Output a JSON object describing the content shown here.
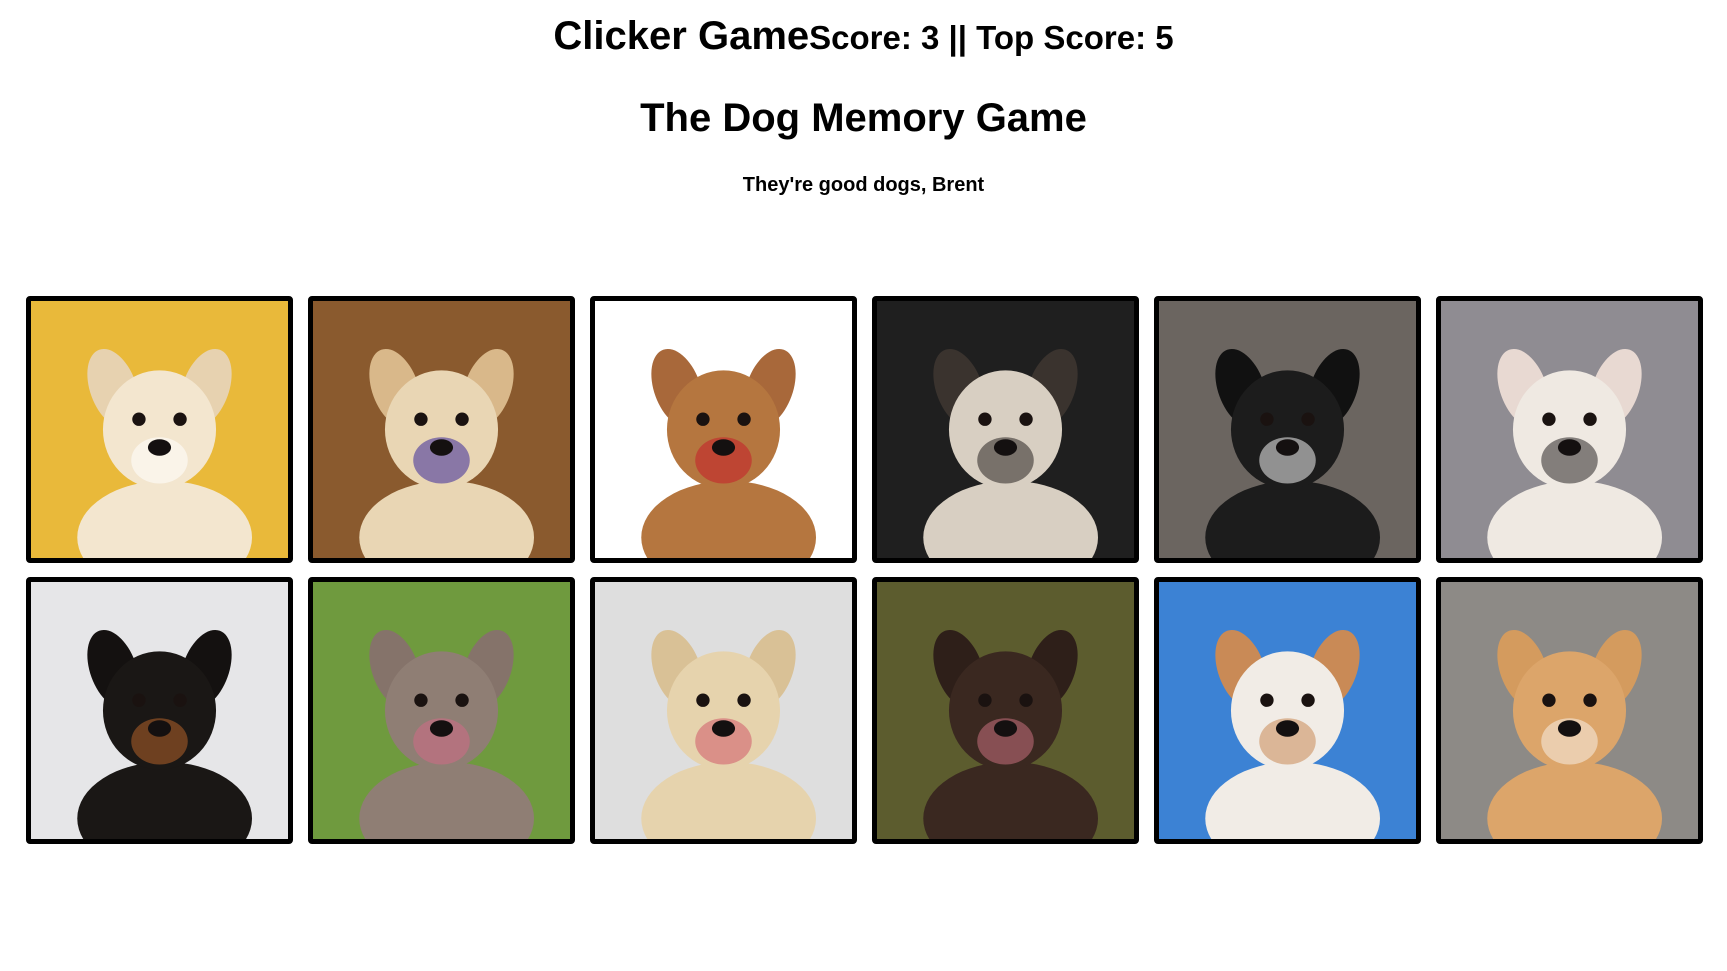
{
  "navbar": {
    "brand": "Clicker Game",
    "score_text": "Score: 3 || Top Score: 5"
  },
  "jumbotron": {
    "title": "The Dog Memory Game",
    "subtitle": "They're good dogs, Brent"
  },
  "cards": [
    {
      "icon": "golden-puppy-stethoscope-image",
      "bg": "#e9b93a",
      "fur": "#f3e6cf",
      "ear": "#e7d2b0",
      "accent": "#ffffff"
    },
    {
      "icon": "labrador-sunglasses-image",
      "bg": "#8a5a2e",
      "fur": "#e9d6b4",
      "ear": "#d9b88a",
      "accent": "#3a2a9a"
    },
    {
      "icon": "pitbull-rose-image",
      "bg": "#ffffff",
      "fur": "#b5763f",
      "ear": "#a8683a",
      "accent": "#c41e2a"
    },
    {
      "icon": "pug-portrait-image",
      "bg": "#1f1f1f",
      "fur": "#d8cfc2",
      "ear": "#3a332e",
      "accent": "#2a2522"
    },
    {
      "icon": "black-white-puppy-image",
      "bg": "#6b6560",
      "fur": "#1c1c1c",
      "ear": "#111111",
      "accent": "#f2f2f2"
    },
    {
      "icon": "french-bulldog-image",
      "bg": "#8f8c92",
      "fur": "#efe9e2",
      "ear": "#e8d9d2",
      "accent": "#2a2626"
    },
    {
      "icon": "rottweiler-image",
      "bg": "#e6e6e8",
      "fur": "#1a1715",
      "ear": "#141110",
      "accent": "#b5622a"
    },
    {
      "icon": "grey-pitbull-image",
      "bg": "#6f9a3e",
      "fur": "#8f7e74",
      "ear": "#85736a",
      "accent": "#d26a86"
    },
    {
      "icon": "terrier-licking-image",
      "bg": "#dedede",
      "fur": "#e6d3ad",
      "ear": "#d9c196",
      "accent": "#cf5a6a"
    },
    {
      "icon": "chocolate-lab-image",
      "bg": "#5c5c2e",
      "fur": "#3a2820",
      "ear": "#2e1f19",
      "accent": "#c7707e"
    },
    {
      "icon": "brown-white-puppy-image",
      "bg": "#3c82d4",
      "fur": "#f1ece6",
      "ear": "#c98a56",
      "accent": "#c98a56"
    },
    {
      "icon": "corgi-beach-image",
      "bg": "#8d8a86",
      "fur": "#dca56a",
      "ear": "#d49b5e",
      "accent": "#f7efe4"
    }
  ]
}
